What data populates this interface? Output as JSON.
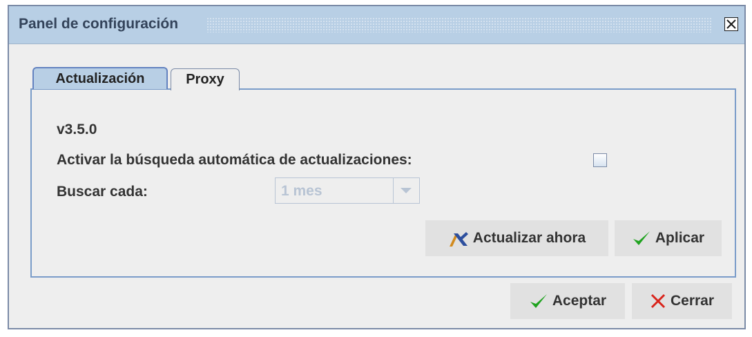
{
  "window": {
    "title": "Panel de configuración"
  },
  "tabs": [
    {
      "label": "Actualización",
      "active": true
    },
    {
      "label": "Proxy",
      "active": false
    }
  ],
  "update_panel": {
    "version": "v3.5.0",
    "auto_check_label": "Activar la búsqueda automática de actualizaciones:",
    "auto_check_checked": false,
    "interval_label": "Buscar cada:",
    "interval_value": "1 mes",
    "interval_enabled": false,
    "update_now_label": "Actualizar ahora",
    "apply_label": "Aplicar"
  },
  "footer": {
    "accept_label": "Aceptar",
    "close_label": "Cerrar"
  },
  "colors": {
    "titlebar": "#b8cfe5",
    "panel_border": "#7a9cc9",
    "check_green": "#1fa31f",
    "close_red": "#d9241b"
  },
  "icons": {
    "close": "close-icon",
    "dropdown": "chevron-down-icon",
    "update": "aeat-logo-icon",
    "apply": "checkmark-icon",
    "accept": "checkmark-icon",
    "cancel": "x-icon"
  }
}
